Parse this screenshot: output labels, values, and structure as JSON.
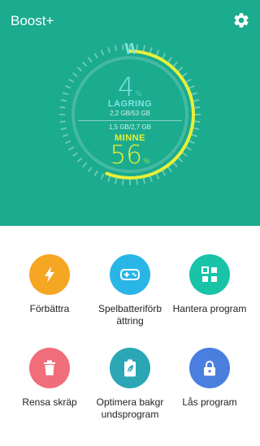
{
  "app": {
    "title": "Boost+"
  },
  "gauge": {
    "storage": {
      "percent": "4",
      "unit": "%",
      "label": "LAGRING",
      "detail": "2,2 GB/53 GB",
      "value": 0.04
    },
    "memory": {
      "percent": "56",
      "unit": "%",
      "label": "MINNE",
      "detail": "1,5 GB/2,7 GB",
      "value": 0.56
    }
  },
  "colors": {
    "panel": "#1bab8e",
    "storage_accent": "#7ee3e6",
    "memory_accent": "#e7f03a",
    "improve": "#f5a623",
    "game_battery": "#29b6e6",
    "manage_apps": "#18c3a8",
    "clean_junk": "#f06d7a",
    "optimize_bg": "#2aa6b5",
    "lock_apps": "#4a7fe0"
  },
  "actions": [
    {
      "id": "improve",
      "label": "Förbättra",
      "icon": "lightning-icon"
    },
    {
      "id": "game_battery",
      "label": "Spelbatteriförb ättring",
      "icon": "gamepad-icon"
    },
    {
      "id": "manage_apps",
      "label": "Hantera program",
      "icon": "grid-icon"
    },
    {
      "id": "clean_junk",
      "label": "Rensa skräp",
      "icon": "trash-icon"
    },
    {
      "id": "optimize_bg",
      "label": "Optimera bakgr undsprogram",
      "icon": "battery-leaf-icon"
    },
    {
      "id": "lock_apps",
      "label": "Lås program",
      "icon": "lock-icon"
    }
  ]
}
